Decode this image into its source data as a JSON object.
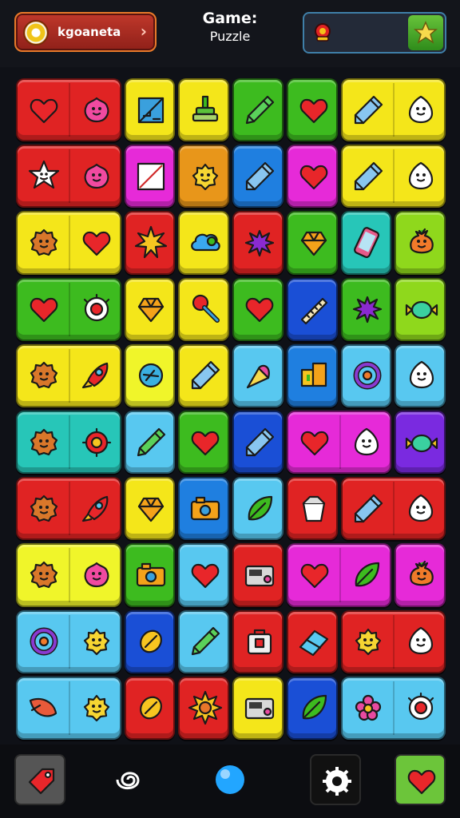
{
  "header": {
    "player_name": "kgoaneta",
    "title_line1": "Game:",
    "title_line2": "Puzzle"
  },
  "icons": {
    "player_coin": "coin-icon",
    "player_chevron": "chevron-right-icon",
    "flag": "flag-icon",
    "star": "star-icon"
  },
  "colors": {
    "red": "#e02323",
    "yellow": "#f4e61a",
    "green": "#3dbb1f",
    "lime": "#8fd81c",
    "blue": "#1f7fe0",
    "darkblue": "#1a4fd6",
    "sky": "#58c8f0",
    "magenta": "#e62ad8",
    "orange": "#e8961a",
    "teal": "#27c6b8",
    "lightyellow": "#f0f52a",
    "purple": "#7a2ae0"
  },
  "board": {
    "tiles": [
      {
        "row": 0,
        "col": 0,
        "span": 2,
        "color": "red",
        "icons": [
          "heart-icon",
          "blob-face-icon"
        ]
      },
      {
        "row": 0,
        "col": 2,
        "span": 1,
        "color": "yellow",
        "icons": [
          "blueprint-icon"
        ]
      },
      {
        "row": 0,
        "col": 3,
        "span": 1,
        "color": "yellow",
        "icons": [
          "stamp-icon"
        ]
      },
      {
        "row": 0,
        "col": 4,
        "span": 1,
        "color": "green",
        "icons": [
          "marker-icon"
        ]
      },
      {
        "row": 0,
        "col": 5,
        "span": 1,
        "color": "green",
        "icons": [
          "heart-icon"
        ]
      },
      {
        "row": 0,
        "col": 6,
        "span": 2,
        "color": "yellow",
        "icons": [
          "pencil-icon",
          "ghost-face-icon"
        ]
      },
      {
        "row": 1,
        "col": 0,
        "span": 2,
        "color": "red",
        "icons": [
          "star-face-icon",
          "blob-face-icon"
        ]
      },
      {
        "row": 1,
        "col": 2,
        "span": 1,
        "color": "magenta",
        "icons": [
          "frame-icon"
        ]
      },
      {
        "row": 1,
        "col": 3,
        "span": 1,
        "color": "orange",
        "icons": [
          "smiley-icon"
        ]
      },
      {
        "row": 1,
        "col": 4,
        "span": 1,
        "color": "blue",
        "icons": [
          "pencil-icon"
        ]
      },
      {
        "row": 1,
        "col": 5,
        "span": 1,
        "color": "magenta",
        "icons": [
          "heart-icon"
        ]
      },
      {
        "row": 1,
        "col": 6,
        "span": 2,
        "color": "yellow",
        "icons": [
          "pencil-icon",
          "ghost-face-icon"
        ]
      },
      {
        "row": 2,
        "col": 0,
        "span": 2,
        "color": "yellow",
        "icons": [
          "cookie-face-icon",
          "heart-icon"
        ]
      },
      {
        "row": 2,
        "col": 2,
        "span": 1,
        "color": "red",
        "icons": [
          "burst-icon"
        ]
      },
      {
        "row": 2,
        "col": 3,
        "span": 1,
        "color": "yellow",
        "icons": [
          "cloud-icon"
        ]
      },
      {
        "row": 2,
        "col": 4,
        "span": 1,
        "color": "red",
        "icons": [
          "splat-icon"
        ]
      },
      {
        "row": 2,
        "col": 5,
        "span": 1,
        "color": "green",
        "icons": [
          "gem-icon"
        ]
      },
      {
        "row": 2,
        "col": 6,
        "span": 1,
        "color": "teal",
        "icons": [
          "phone-icon"
        ]
      },
      {
        "row": 2,
        "col": 7,
        "span": 1,
        "color": "lime",
        "icons": [
          "fruit-face-icon"
        ]
      },
      {
        "row": 3,
        "col": 0,
        "span": 2,
        "color": "green",
        "icons": [
          "heart-icon",
          "eye-icon"
        ]
      },
      {
        "row": 3,
        "col": 2,
        "span": 1,
        "color": "yellow",
        "icons": [
          "gem-icon"
        ]
      },
      {
        "row": 3,
        "col": 3,
        "span": 1,
        "color": "yellow",
        "icons": [
          "pin-icon"
        ]
      },
      {
        "row": 3,
        "col": 4,
        "span": 1,
        "color": "green",
        "icons": [
          "heart-icon"
        ]
      },
      {
        "row": 3,
        "col": 5,
        "span": 1,
        "color": "darkblue",
        "icons": [
          "ruler-icon"
        ]
      },
      {
        "row": 3,
        "col": 6,
        "span": 1,
        "color": "green",
        "icons": [
          "splat-icon"
        ]
      },
      {
        "row": 3,
        "col": 7,
        "span": 1,
        "color": "lime",
        "icons": [
          "candy-icon"
        ]
      },
      {
        "row": 4,
        "col": 0,
        "span": 2,
        "color": "yellow",
        "icons": [
          "cookie-face-icon",
          "rocket-icon"
        ]
      },
      {
        "row": 4,
        "col": 2,
        "span": 1,
        "color": "lightyellow",
        "icons": [
          "compass-icon"
        ]
      },
      {
        "row": 4,
        "col": 3,
        "span": 1,
        "color": "yellow",
        "icons": [
          "pencil-icon"
        ]
      },
      {
        "row": 4,
        "col": 4,
        "span": 1,
        "color": "sky",
        "icons": [
          "cone-icon"
        ]
      },
      {
        "row": 4,
        "col": 5,
        "span": 1,
        "color": "blue",
        "icons": [
          "box-icon"
        ]
      },
      {
        "row": 4,
        "col": 6,
        "span": 1,
        "color": "sky",
        "icons": [
          "ring-icon"
        ]
      },
      {
        "row": 4,
        "col": 7,
        "span": 1,
        "color": "sky",
        "icons": [
          "ghost-face-icon"
        ]
      },
      {
        "row": 5,
        "col": 0,
        "span": 2,
        "color": "teal",
        "icons": [
          "cookie-face-icon",
          "gear-icon"
        ]
      },
      {
        "row": 5,
        "col": 2,
        "span": 1,
        "color": "sky",
        "icons": [
          "marker-icon"
        ]
      },
      {
        "row": 5,
        "col": 3,
        "span": 1,
        "color": "green",
        "icons": [
          "heart-icon"
        ]
      },
      {
        "row": 5,
        "col": 4,
        "span": 1,
        "color": "darkblue",
        "icons": [
          "pencil-icon"
        ]
      },
      {
        "row": 5,
        "col": 5,
        "span": 2,
        "color": "magenta",
        "icons": [
          "heart-icon",
          "ghost-face-icon"
        ]
      },
      {
        "row": 5,
        "col": 7,
        "span": 1,
        "color": "purple",
        "icons": [
          "candy-icon"
        ]
      },
      {
        "row": 6,
        "col": 0,
        "span": 2,
        "color": "red",
        "icons": [
          "cookie-face-icon",
          "rocket-icon"
        ]
      },
      {
        "row": 6,
        "col": 2,
        "span": 1,
        "color": "yellow",
        "icons": [
          "gem-icon"
        ]
      },
      {
        "row": 6,
        "col": 3,
        "span": 1,
        "color": "blue",
        "icons": [
          "camera-icon"
        ]
      },
      {
        "row": 6,
        "col": 4,
        "span": 1,
        "color": "sky",
        "icons": [
          "leaf-icon"
        ]
      },
      {
        "row": 6,
        "col": 5,
        "span": 1,
        "color": "red",
        "icons": [
          "bucket-icon"
        ]
      },
      {
        "row": 6,
        "col": 6,
        "span": 2,
        "color": "red",
        "icons": [
          "pencil-icon",
          "ghost-face-icon"
        ]
      },
      {
        "row": 7,
        "col": 0,
        "span": 2,
        "color": "lightyellow",
        "icons": [
          "cookie-face-icon",
          "blob-face-icon"
        ]
      },
      {
        "row": 7,
        "col": 2,
        "span": 1,
        "color": "green",
        "icons": [
          "camera-icon"
        ]
      },
      {
        "row": 7,
        "col": 3,
        "span": 1,
        "color": "sky",
        "icons": [
          "heart-icon"
        ]
      },
      {
        "row": 7,
        "col": 4,
        "span": 1,
        "color": "red",
        "icons": [
          "radio-icon"
        ]
      },
      {
        "row": 7,
        "col": 5,
        "span": 2,
        "color": "magenta",
        "icons": [
          "heart-icon",
          "leaf-icon"
        ]
      },
      {
        "row": 7,
        "col": 7,
        "span": 1,
        "color": "magenta",
        "icons": [
          "fruit-face-icon"
        ]
      },
      {
        "row": 8,
        "col": 0,
        "span": 2,
        "color": "sky",
        "icons": [
          "ring-icon",
          "smiley-icon"
        ]
      },
      {
        "row": 8,
        "col": 2,
        "span": 1,
        "color": "darkblue",
        "icons": [
          "lemon-icon"
        ]
      },
      {
        "row": 8,
        "col": 3,
        "span": 1,
        "color": "sky",
        "icons": [
          "marker-icon"
        ]
      },
      {
        "row": 8,
        "col": 4,
        "span": 1,
        "color": "red",
        "icons": [
          "bag-icon"
        ]
      },
      {
        "row": 8,
        "col": 5,
        "span": 1,
        "color": "red",
        "icons": [
          "eraser-icon"
        ]
      },
      {
        "row": 8,
        "col": 6,
        "span": 2,
        "color": "red",
        "icons": [
          "smiley-icon",
          "ghost-face-icon"
        ]
      },
      {
        "row": 9,
        "col": 0,
        "span": 2,
        "color": "sky",
        "icons": [
          "fish-icon",
          "smiley-icon"
        ]
      },
      {
        "row": 9,
        "col": 2,
        "span": 1,
        "color": "red",
        "icons": [
          "lemon-icon"
        ]
      },
      {
        "row": 9,
        "col": 3,
        "span": 1,
        "color": "red",
        "icons": [
          "sun-icon"
        ]
      },
      {
        "row": 9,
        "col": 4,
        "span": 1,
        "color": "yellow",
        "icons": [
          "radio-icon"
        ]
      },
      {
        "row": 9,
        "col": 5,
        "span": 1,
        "color": "darkblue",
        "icons": [
          "leaf-icon"
        ]
      },
      {
        "row": 9,
        "col": 6,
        "span": 2,
        "color": "sky",
        "icons": [
          "flower-icon",
          "eye-icon"
        ]
      }
    ]
  },
  "toolbar": {
    "buttons": [
      {
        "name": "back-button",
        "icon": "tag-icon",
        "color": "#555"
      },
      {
        "name": "shuffle-button",
        "icon": "swirl-icon",
        "color": "none"
      },
      {
        "name": "hint-button",
        "icon": "orb-icon",
        "color": "none"
      },
      {
        "name": "settings-button",
        "icon": "gear-icon",
        "color": "#111"
      },
      {
        "name": "favorite-button",
        "icon": "heart-icon",
        "color": "#6cc53a"
      }
    ]
  }
}
